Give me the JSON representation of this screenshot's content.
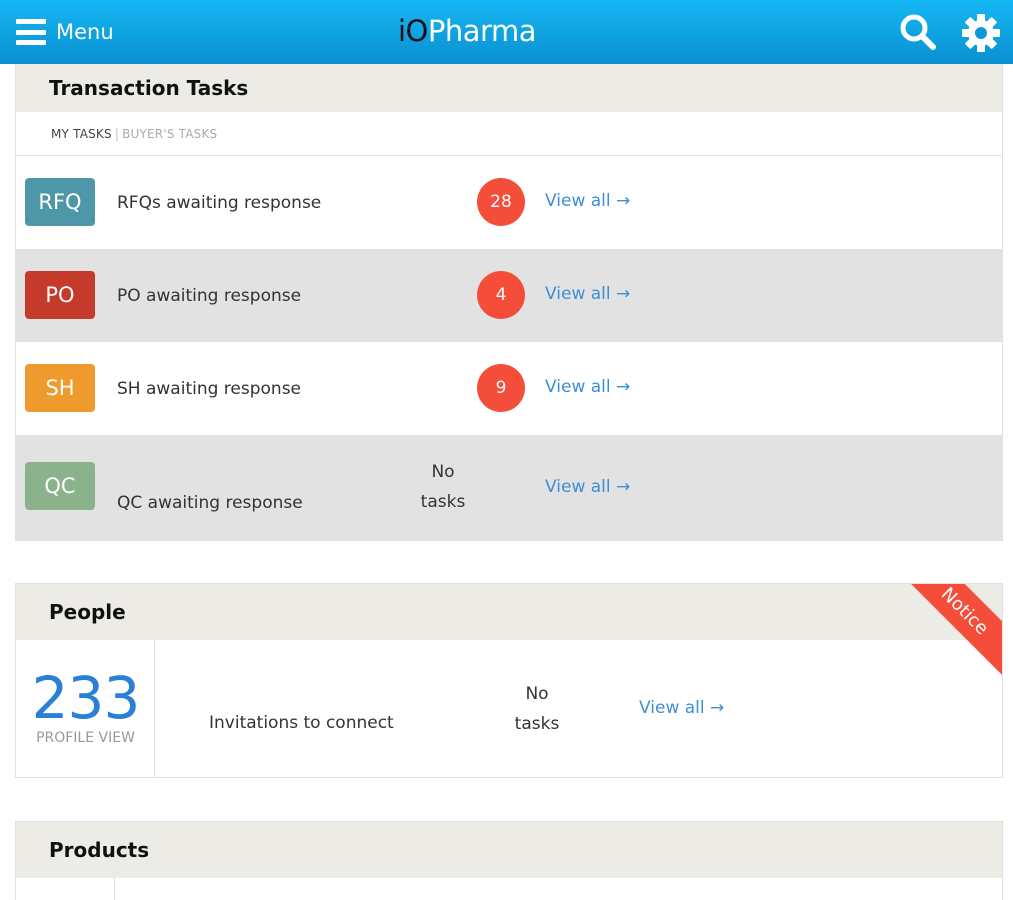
{
  "header": {
    "menu_label": "Menu",
    "brand_prefix": "iO",
    "brand_suffix": "Pharma"
  },
  "colors": {
    "header_top": "#15b8f4",
    "header_bottom": "#0a8fd0",
    "rfq": "#4e97a9",
    "po": "#c63a2b",
    "sh": "#ee9a2c",
    "qc": "#8ab38b",
    "count_badge": "#f44d3a",
    "link": "#3d8ed8"
  },
  "transaction_tasks": {
    "title": "Transaction Tasks",
    "tabs": {
      "my_tasks": "MY TASKS",
      "separator": "|",
      "buyers_tasks": "BUYER'S TASKS"
    },
    "rows": [
      {
        "badge": "RFQ",
        "label": "RFQs awaiting response",
        "count": "28",
        "link": "View all →"
      },
      {
        "badge": "PO",
        "label": "PO awaiting response",
        "count": "4",
        "link": "View all →"
      },
      {
        "badge": "SH",
        "label": "SH awaiting response",
        "count": "9",
        "link": "View all →"
      },
      {
        "badge": "QC",
        "label": "QC awaiting response",
        "no_tasks_1": "No",
        "no_tasks_2": "tasks",
        "link": "View all →"
      }
    ]
  },
  "people": {
    "title": "People",
    "profile_views": "233",
    "profile_label": "PROFILE VIEW",
    "invitations_label": "Invitations to connect",
    "no_tasks_1": "No",
    "no_tasks_2": "tasks",
    "link": "View all →",
    "notice": "Notice"
  },
  "products": {
    "title": "Products"
  }
}
